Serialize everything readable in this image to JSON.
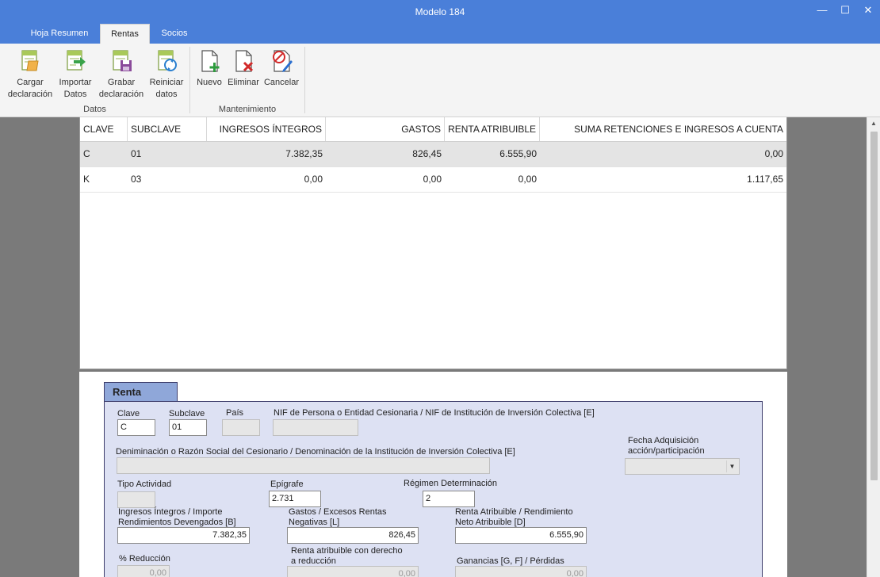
{
  "window": {
    "title": "Modelo 184",
    "controls": {
      "minimize": "—",
      "maximize": "☐",
      "close": "✕"
    }
  },
  "tabs": [
    {
      "label": "Hoja Resumen"
    },
    {
      "label": "Rentas"
    },
    {
      "label": "Socios"
    }
  ],
  "ribbon": {
    "groups": [
      {
        "label": "Datos"
      },
      {
        "label": "Mantenimiento"
      }
    ],
    "buttons": [
      {
        "label1": "Cargar",
        "label2": "declaración",
        "icon": "load-declaration-icon"
      },
      {
        "label1": "Importar",
        "label2": "Datos",
        "icon": "import-data-icon"
      },
      {
        "label1": "Grabar",
        "label2": "declaración",
        "icon": "save-declaration-icon"
      },
      {
        "label1": "Reiniciar",
        "label2": "datos",
        "icon": "reset-data-icon"
      },
      {
        "label1": "Nuevo",
        "label2": "",
        "icon": "new-icon"
      },
      {
        "label1": "Eliminar",
        "label2": "",
        "icon": "delete-icon"
      },
      {
        "label1": "Cancelar",
        "label2": "",
        "icon": "cancel-icon"
      }
    ]
  },
  "grid": {
    "columns": [
      "CLAVE",
      "SUBCLAVE",
      "INGRESOS ÍNTEGROS",
      "GASTOS",
      "RENTA ATRIBUIBLE",
      "SUMA RETENCIONES E INGRESOS A CUENTA"
    ],
    "rows": [
      [
        "C",
        "01",
        "7.382,35",
        "826,45",
        "6.555,90",
        "0,00"
      ],
      [
        "K",
        "03",
        "0,00",
        "0,00",
        "0,00",
        "1.117,65"
      ]
    ],
    "selected_row": 0
  },
  "form": {
    "section_title": "Renta",
    "clave": {
      "label": "Clave",
      "value": "C"
    },
    "subclave": {
      "label": "Subclave",
      "value": "01"
    },
    "pais": {
      "label": "País",
      "value": ""
    },
    "nif": {
      "label": "NIF de Persona o Entidad Cesionaria / NIF de Institución de Inversión Colectiva [E]",
      "value": ""
    },
    "fecha": {
      "label1": "Fecha Adquisición",
      "label2": "acción/participación",
      "value": ""
    },
    "denominacion": {
      "label": "Deniminación o Razón Social del Cesionario / Denominación de la Institución de Inversión Colectiva [E]",
      "value": ""
    },
    "tipo_actividad": {
      "label": "Tipo Actividad",
      "value": ""
    },
    "epigrafe": {
      "label": "Epígrafe",
      "value": "2.731"
    },
    "regimen": {
      "label": "Régimen Determinación",
      "value": "2"
    },
    "ingresos": {
      "label1": "Ingresos Íntegros / Importe",
      "label2": "Rendimientos Devengados [B]",
      "value": "7.382,35"
    },
    "gastos": {
      "label1": "Gastos / Excesos Rentas",
      "label2": "Negativas [L]",
      "value": "826,45"
    },
    "renta": {
      "label1": "Renta Atribuible / Rendimiento",
      "label2": "Neto Atribuible [D]",
      "value": "6.555,90"
    },
    "reduccion": {
      "label": "% Reducción",
      "value": "0,00"
    },
    "renta_reduccion": {
      "label1": "Renta atribuible con derecho",
      "label2": "a reducción",
      "value": "0,00"
    },
    "ganancias": {
      "label": "Ganancias [G, F] / Pérdidas",
      "value": "0,00"
    }
  }
}
